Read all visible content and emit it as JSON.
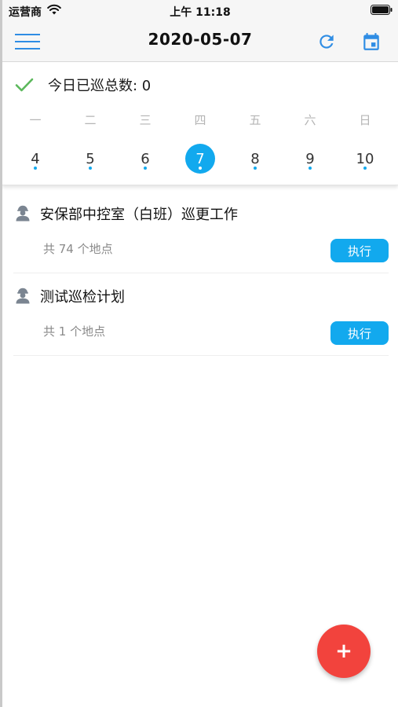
{
  "status_bar": {
    "carrier": "运营商",
    "time": "上午 11:18"
  },
  "nav": {
    "title": "2020-05-07",
    "menu_icon": "menu-icon",
    "refresh_icon": "refresh-icon",
    "calendar_icon": "calendar-icon"
  },
  "summary": {
    "text": "今日已巡总数: 0"
  },
  "calendar": {
    "weekdays": [
      "一",
      "二",
      "三",
      "四",
      "五",
      "六",
      "日"
    ],
    "dates": [
      "4",
      "5",
      "6",
      "7",
      "8",
      "9",
      "10"
    ],
    "selected_index": 3
  },
  "tasks": [
    {
      "title": "安保部中控室（白班）巡更工作",
      "count": "共 74 个地点",
      "action": "执行"
    },
    {
      "title": "测试巡检计划",
      "count": "共 1 个地点",
      "action": "执行"
    }
  ],
  "fab": {
    "label": "+"
  },
  "colors": {
    "accent": "#12a9ee",
    "fab": "#f2433d",
    "check": "#5cb85c"
  }
}
